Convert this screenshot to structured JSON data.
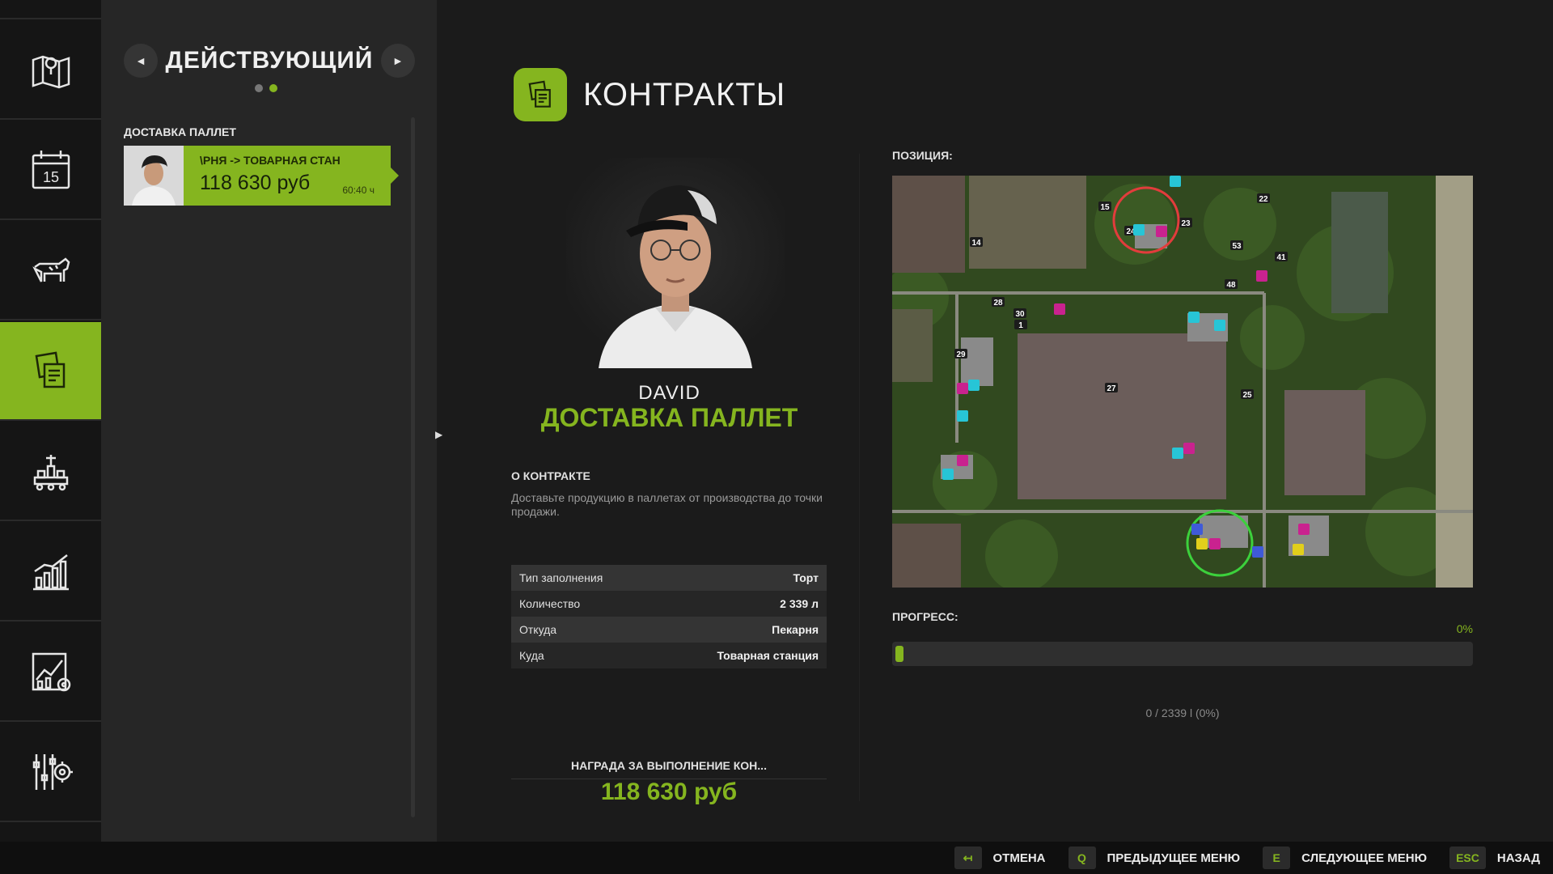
{
  "rail": {
    "items": [
      {
        "name": "map-icon"
      },
      {
        "name": "calendar-icon",
        "day": "15"
      },
      {
        "name": "cow-icon"
      },
      {
        "name": "contracts-icon",
        "active": true
      },
      {
        "name": "production-icon"
      },
      {
        "name": "prices-chart-icon"
      },
      {
        "name": "statistics-icon"
      },
      {
        "name": "settings-icon"
      }
    ]
  },
  "list": {
    "title": "ДЕЙСТВУЮЩИЙ",
    "prev": "◄",
    "next": "►",
    "section": "ДОСТАВКА ПАЛЛЕТ",
    "card": {
      "route": "\\РНЯ -> ТОВАРНАЯ СТАН",
      "reward": "118 630 руб",
      "time": "60:40 ч"
    }
  },
  "detail": {
    "title": "КОНТРАКТЫ",
    "person_name": "DAVID",
    "contract_type": "ДОСТАВКА ПАЛЛЕТ",
    "about_label": "О КОНТРАКТЕ",
    "about_text": "Доставьте продукцию в паллетах от производства до точки продажи.",
    "rows": [
      {
        "key": "Тип заполнения",
        "value": "Торт"
      },
      {
        "key": "Количество",
        "value": "2 339 л"
      },
      {
        "key": "Откуда",
        "value": "Пекарня"
      },
      {
        "key": "Куда",
        "value": "Товарная станция"
      }
    ],
    "reward_label": "НАГРАДА ЗА ВЫПОЛНЕНИЕ КОН...",
    "reward_value": "118 630 руб"
  },
  "map_panel": {
    "label": "ПОЗИЦИЯ:",
    "field_numbers": [
      "15",
      "22",
      "23",
      "24",
      "53",
      "41",
      "14",
      "48",
      "28",
      "30",
      "1",
      "29",
      "25",
      "27"
    ]
  },
  "progress": {
    "label": "ПРОГРЕСС:",
    "percent_text": "0%",
    "fraction": 0,
    "detail": "0 / 2339 l (0%)"
  },
  "bottom_bar": {
    "hints": [
      {
        "key": "↤",
        "label": "ОТМЕНА"
      },
      {
        "key": "Q",
        "label": "ПРЕДЫДУЩЕЕ МЕНЮ"
      },
      {
        "key": "E",
        "label": "СЛЕДУЮЩЕЕ МЕНЮ"
      },
      {
        "key": "ESC",
        "label": "НАЗАД"
      }
    ]
  },
  "colors": {
    "accent": "#85b51f",
    "panel": "#262626",
    "background": "#1b1b1b"
  }
}
